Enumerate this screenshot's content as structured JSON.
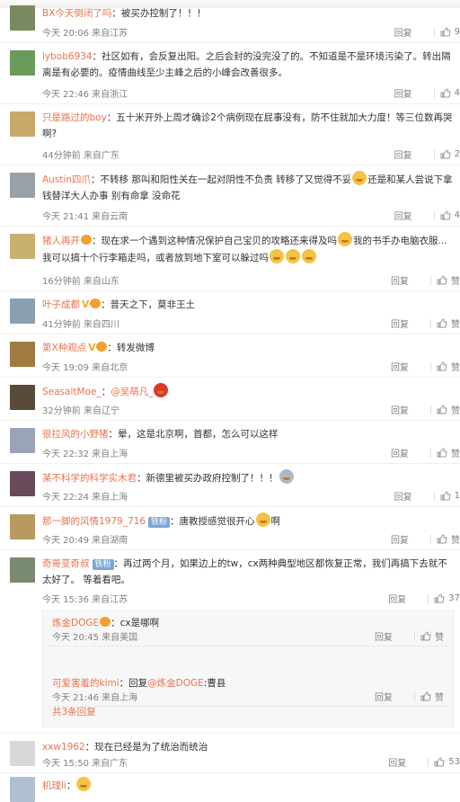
{
  "comments": [
    {
      "user": "BX今天倒闭了吗",
      "text": "：被买办控制了！！！",
      "time": "今天 20:06 来自江苏",
      "reply": "回复",
      "likes": "9",
      "avatar": "#7a8a60"
    },
    {
      "user": "lybob6934",
      "text": "：社区如有，会反复出阳。之后会封的没完没了的。不知道是不是环境污染了。转出隔离是有必要的。疫情曲线至少主峰之后的小峰会改善很多。",
      "time": "今天 22:46 来自浙江",
      "reply": "回复",
      "likes": "4",
      "avatar": "#6a9a5a"
    },
    {
      "user": "只是路过的boy",
      "text": "：五十米开外上周才确诊2个病例现在屁事没有，防不住就加大力度！等三位数再哭啊?",
      "time": "44分钟前 来自广东",
      "reply": "回复",
      "likes": "2",
      "avatar": "#c9a86a"
    },
    {
      "user": "Austin四爪",
      "text": "：不转移 那叫和阳性关在一起对阴性不负责 转移了又觉得不妥",
      "emoji": "😅",
      "text2": "还是和某人尝说下拿钱替洋大人办事 别有命拿 没命花",
      "time": "今天 21:41 来自云南",
      "reply": "回复",
      "likes": "4",
      "avatar": "#9aa0a8"
    },
    {
      "user": "猪人再开",
      "text": "：现在求一个遇到这种情况保护自己宝贝的攻略还来得及吗",
      "text2": "我的书手办电脑衣服...我可以搞十个行李箱走吗，或者放到地下室可以躲过吗",
      "time": "16分钟前 来自山东",
      "reply": "回复",
      "likes": "赞",
      "avatar": "#c8b070"
    },
    {
      "user": "叶子成都",
      "text": "：普天之下，莫非王土",
      "time": "41分钟前 来自四川",
      "reply": "回复",
      "likes": "赞",
      "avatar": "#8aa0b0"
    },
    {
      "user": "第X种观点",
      "text": "：转发微博",
      "time": "今天 19:09 来自北京",
      "reply": "回复",
      "likes": "赞",
      "avatar": "#a07a40"
    },
    {
      "user": "SeasaltMoe_",
      "text": "：",
      "mention": "@吴萌凡_",
      "time": "32分钟前 来自辽宁",
      "reply": "回复",
      "likes": "赞",
      "avatar": "#5a4a3a"
    },
    {
      "user": "很拉风的小野猪",
      "text": "：晕，这是北京啊，首都，怎么可以这样",
      "time": "今天 22:32 来自上海",
      "reply": "回复",
      "likes": "赞",
      "avatar": "#9aa4b8"
    },
    {
      "user": "某不科学的科学实木君",
      "text": "：新德里被买办政府控制了！！！",
      "time": "今天 22:24 来自上海",
      "reply": "回复",
      "likes": "1",
      "avatar": "#6a4a5a"
    },
    {
      "user": "那一脚的风情1979_716",
      "tag": "铁粉",
      "text": "：唐教授感觉很开心",
      "text2": "啊",
      "time": "今天 20:49 来自湖南",
      "reply": "回复",
      "likes": "赞",
      "avatar": "#b89a60"
    },
    {
      "user": "奇哥变奇叔",
      "tag": "铁粉",
      "text": "：再过两个月，如果边上的tw，cx两种典型地区都恢复正常，我们再搞下去就不太好了。 等着看吧。",
      "time": "今天 15:36 来自江苏",
      "reply": "回复",
      "likes": "37",
      "avatar": "#7a8a70"
    },
    {
      "user": "xxw1962",
      "text": "：现在已经是为了统治而统治",
      "time": "今天 15:50 来自广东",
      "reply": "回复",
      "likes": "53",
      "avatar": "#d8d8d8"
    },
    {
      "user": "机理li",
      "text": "：",
      "time": "",
      "reply": "",
      "likes": "",
      "avatar": "#b0c0d0"
    }
  ],
  "sub_replies": [
    {
      "user": "炼金DOGE",
      "text": "：cx是哪啊",
      "time": "今天 20:45 来自美国",
      "reply": "回复",
      "likes": "赞"
    },
    {
      "user": "可爱害羞的kimi",
      "text": "：回复",
      "mention": "@炼金DOGE",
      "text2": ":曹县",
      "time": "今天 21:46 来自上海",
      "reply": "回复",
      "likes": "赞"
    }
  ],
  "more_replies": "共3条回复"
}
